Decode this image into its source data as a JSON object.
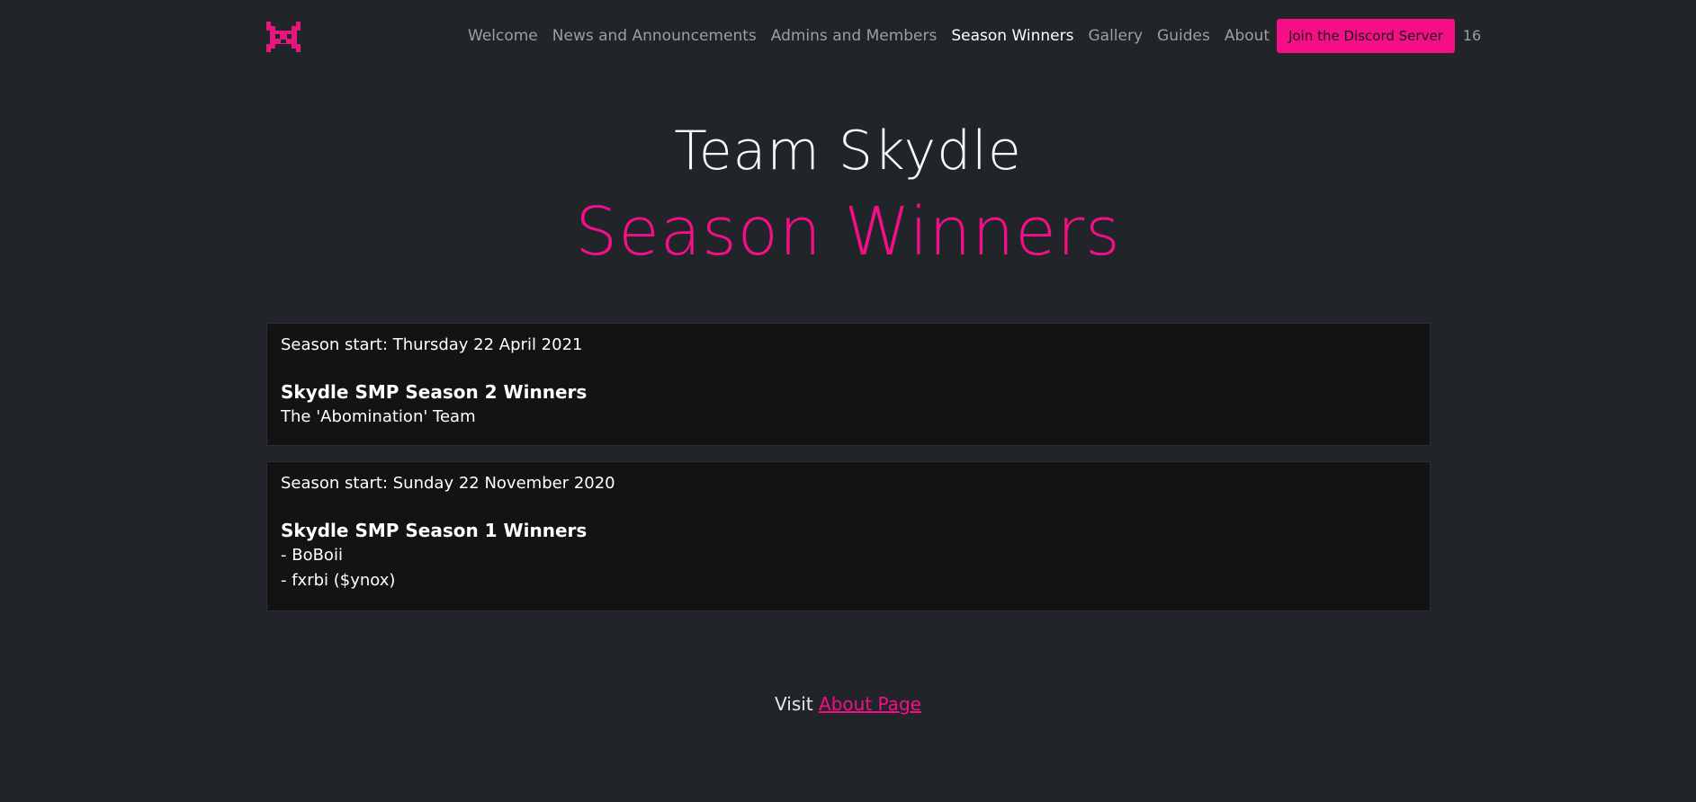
{
  "nav": {
    "logo_icon": "pixel-creature-logo-icon",
    "links": [
      {
        "label": "Welcome"
      },
      {
        "label": "News and Announcements"
      },
      {
        "label": "Admins and Members"
      },
      {
        "label": "Season Winners"
      },
      {
        "label": "Gallery"
      },
      {
        "label": "Guides"
      },
      {
        "label": "About"
      }
    ],
    "active": "Season Winners",
    "discord_button": "Join the Discord Server",
    "count": "16"
  },
  "hero": {
    "title": "Team Skydle",
    "subtitle": "Season Winners"
  },
  "seasons": [
    {
      "start": "Season start: Thursday 22 April 2021",
      "title": "Skydle SMP Season 2 Winners",
      "winners": [
        "The 'Abomination' Team"
      ]
    },
    {
      "start": "Season start: Sunday 22 November 2020",
      "title": "Skydle SMP Season 1 Winners",
      "winners": [
        "- BoBoii",
        "- fxrbi ($ynox)"
      ]
    }
  ],
  "footer": {
    "prefix": "Visit",
    "link": "About Page"
  },
  "colors": {
    "background": "#212428",
    "accent": "#f50f87",
    "card": "#131313"
  }
}
